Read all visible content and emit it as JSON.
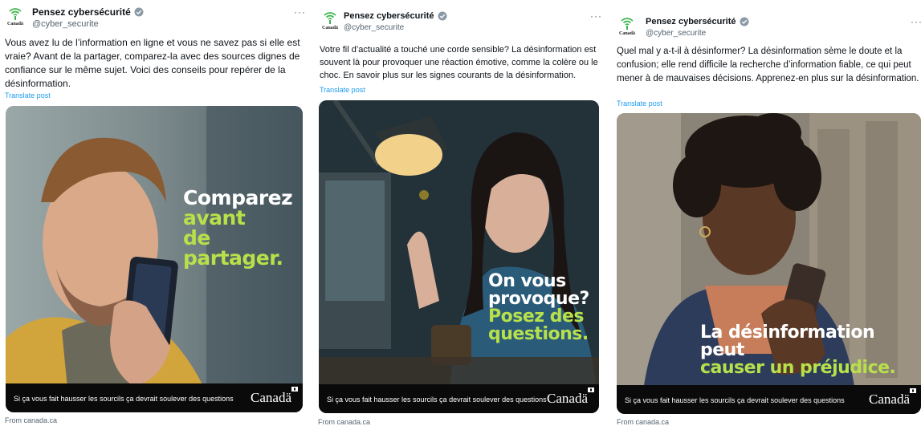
{
  "account": {
    "display_name": "Pensez cybersécurité",
    "handle": "@cyber_securite",
    "logo_text": "Canadä"
  },
  "more_label": "···",
  "translate_label": "Translate post",
  "source_label": "From canada.ca",
  "card_footer": "Si ça vous fait hausser les sourcils ça devrait soulever des questions",
  "canada_wordmark": "Canadä",
  "colors": {
    "accent_green": "#b7e04a",
    "link_blue": "#1d9bf0",
    "footer_black": "#0a0a0a"
  },
  "posts": [
    {
      "text": "Vous avez lu de l’information en ligne et vous ne savez pas si elle est vraie? Avant de la partager, comparez-la avec des sources dignes de confiance sur le même sujet. Voici des conseils pour repérer de la désinformation.",
      "headline_white": "Comparez",
      "headline_green_1": "avant",
      "headline_green_2": "de partager."
    },
    {
      "text": "Votre fil d’actualité a touché une corde sensible? La désinformation est souvent là pour provoquer une réaction émotive, comme la colère ou le choc. En savoir plus sur les signes courants de la désinformation.",
      "headline_white_1": "On vous",
      "headline_white_2": "provoque?",
      "headline_green_1": "Posez des",
      "headline_green_2": "questions."
    },
    {
      "text": "Quel mal y a-t-il à désinformer? La désinformation sème le doute et la confusion; elle rend difficile la recherche d’information fiable, ce qui peut mener à de mauvaises décisions. Apprenez-en plus sur la désinformation.",
      "headline_white": "La désinformation peut",
      "headline_green": "causer un préjudice."
    }
  ]
}
